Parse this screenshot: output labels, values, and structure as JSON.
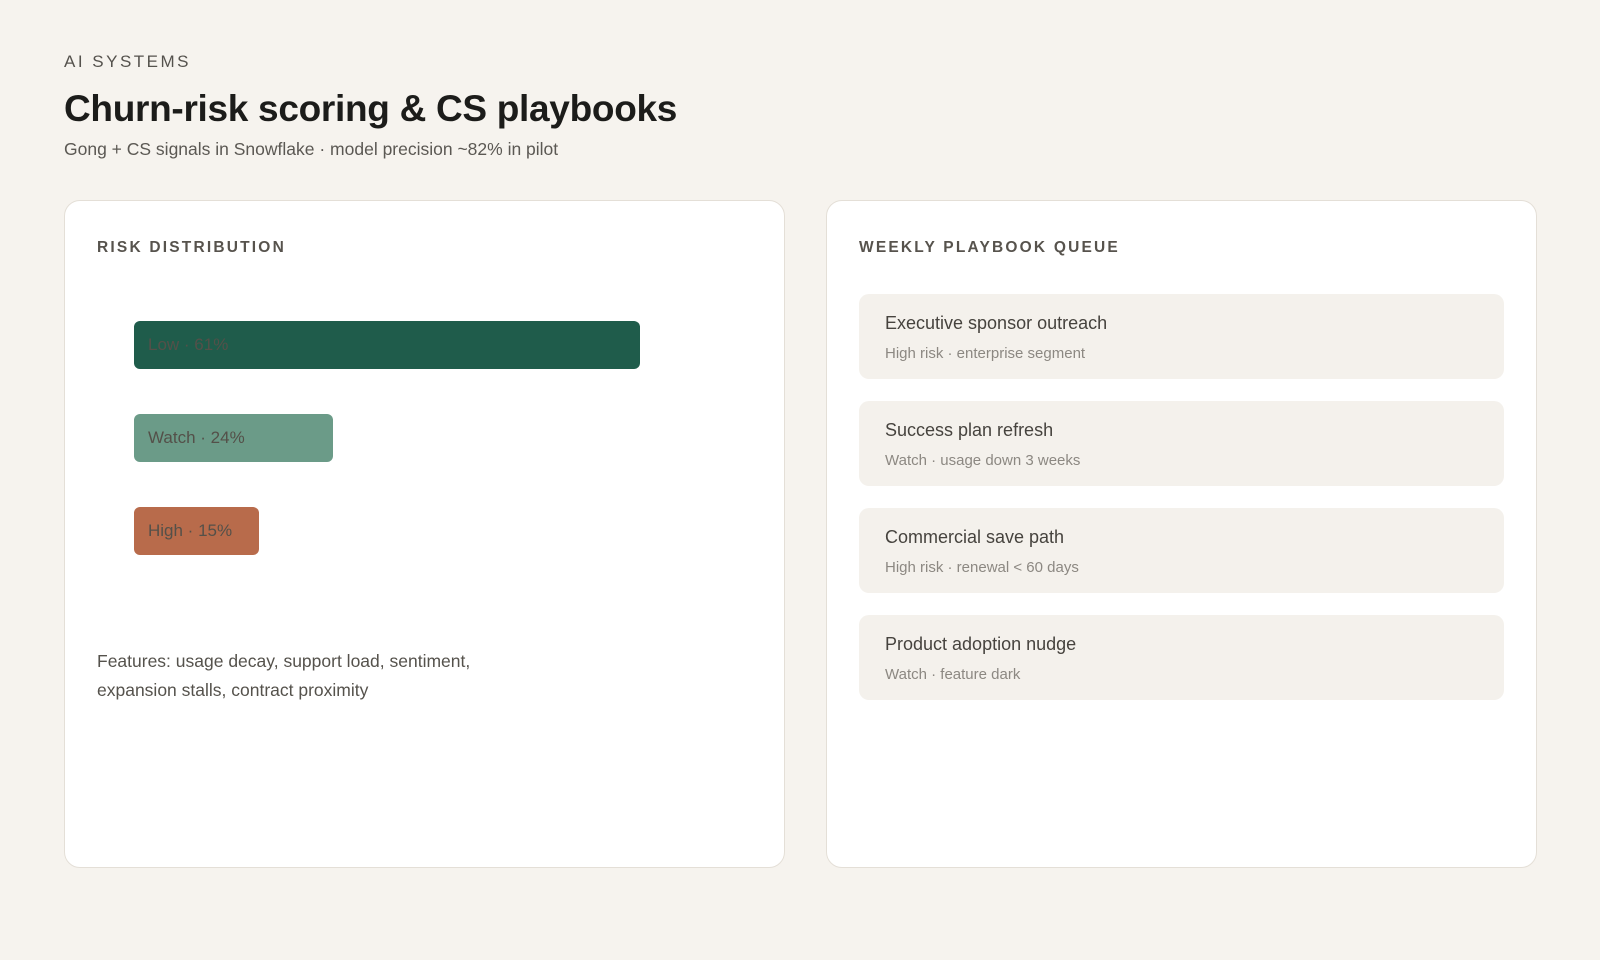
{
  "header": {
    "eyebrow": "AI SYSTEMS",
    "title": "Churn-risk scoring & CS playbooks",
    "subtitle": "Gong + CS signals in Snowflake · model precision ~82% in pilot"
  },
  "risk_panel": {
    "heading": "RISK DISTRIBUTION",
    "features_note": "Features: usage decay, support load, sentiment, expansion stalls, contract proximity"
  },
  "chart_data": {
    "type": "bar",
    "orientation": "horizontal",
    "categories": [
      "Low",
      "Watch",
      "High"
    ],
    "values": [
      61,
      24,
      15
    ],
    "unit": "%",
    "labels": [
      "Low · 61%",
      "Watch · 24%",
      "High · 15%"
    ],
    "colors": [
      "#1f5c4b",
      "#6b9b88",
      "#b86b4b"
    ]
  },
  "queue_panel": {
    "heading": "WEEKLY PLAYBOOK QUEUE",
    "items": [
      {
        "title": "Executive sponsor outreach",
        "detail": "High risk · enterprise segment"
      },
      {
        "title": "Success plan refresh",
        "detail": "Watch · usage down 3 weeks"
      },
      {
        "title": "Commercial save path",
        "detail": "High risk · renewal < 60 days"
      },
      {
        "title": "Product adoption nudge",
        "detail": "Watch · feature dark"
      }
    ]
  }
}
